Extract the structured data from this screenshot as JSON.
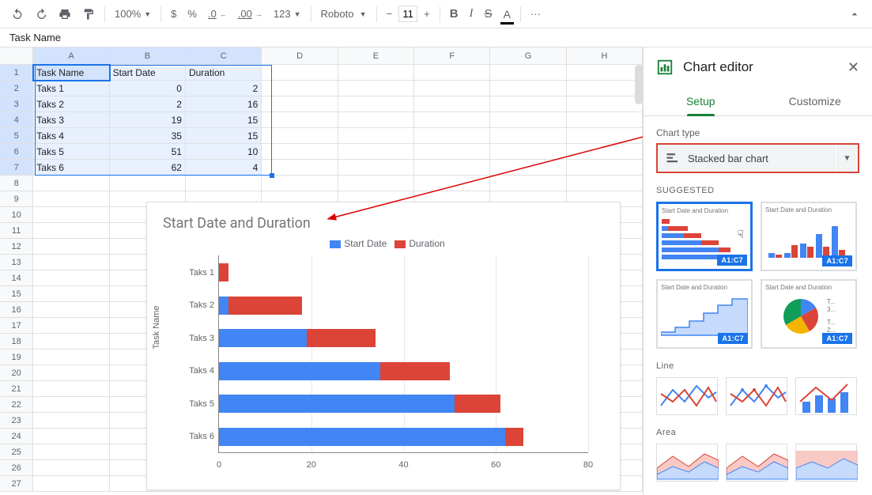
{
  "toolbar": {
    "zoom": "100%",
    "currency": "$",
    "percent": "%",
    "dec_dec": ".0",
    "inc_dec": ".00",
    "formats": "123",
    "font": "Roboto",
    "font_size": "11",
    "bold": "B",
    "italic": "I",
    "strike": "S",
    "text_color": "A",
    "more": "···"
  },
  "formula_bar": {
    "value": "Task Name"
  },
  "columns": [
    "A",
    "B",
    "C",
    "D",
    "E",
    "F",
    "G",
    "H"
  ],
  "rows": [
    {
      "n": 1,
      "cells": [
        "Task Name",
        "Start Date",
        "Duration",
        "",
        "",
        "",
        "",
        ""
      ]
    },
    {
      "n": 2,
      "cells": [
        "Taks 1",
        "0",
        "2",
        "",
        "",
        "",
        "",
        ""
      ]
    },
    {
      "n": 3,
      "cells": [
        "Taks 2",
        "2",
        "16",
        "",
        "",
        "",
        "",
        ""
      ]
    },
    {
      "n": 4,
      "cells": [
        "Taks 3",
        "19",
        "15",
        "",
        "",
        "",
        "",
        ""
      ]
    },
    {
      "n": 5,
      "cells": [
        "Taks 4",
        "35",
        "15",
        "",
        "",
        "",
        "",
        ""
      ]
    },
    {
      "n": 6,
      "cells": [
        "Taks 5",
        "51",
        "10",
        "",
        "",
        "",
        "",
        ""
      ]
    },
    {
      "n": 7,
      "cells": [
        "Taks 6",
        "62",
        "4",
        "",
        "",
        "",
        "",
        ""
      ]
    }
  ],
  "blank_rows": 20,
  "chart": {
    "title": "Start Date and Duration",
    "legend": [
      {
        "label": "Start Date",
        "color": "#4285f4"
      },
      {
        "label": "Duration",
        "color": "#db4437"
      }
    ],
    "y_axis_label": "Task Name"
  },
  "chart_data": {
    "type": "bar",
    "orientation": "horizontal",
    "stacked": true,
    "title": "Start Date and Duration",
    "ylabel": "Task Name",
    "xlabel": "",
    "xlim": [
      0,
      80
    ],
    "x_ticks": [
      0,
      20,
      40,
      60,
      80
    ],
    "categories": [
      "Taks 1",
      "Taks 2",
      "Taks 3",
      "Taks 4",
      "Taks 5",
      "Taks 6"
    ],
    "series": [
      {
        "name": "Start Date",
        "color": "#4285f4",
        "values": [
          0,
          2,
          19,
          35,
          51,
          62
        ]
      },
      {
        "name": "Duration",
        "color": "#db4437",
        "values": [
          2,
          16,
          15,
          15,
          10,
          4
        ]
      }
    ]
  },
  "editor": {
    "title": "Chart editor",
    "tabs": {
      "setup": "Setup",
      "customize": "Customize"
    },
    "chart_type_label": "Chart type",
    "chart_type_value": "Stacked bar chart",
    "suggested_label": "SUGGESTED",
    "range_badge": "A1:C7",
    "suggested_title": "Start Date and Duration",
    "line_label": "Line",
    "area_label": "Area",
    "pie_labels": {
      "t": "T...",
      "n3": "3...",
      "t2": "T...",
      "n2": "2..."
    }
  }
}
